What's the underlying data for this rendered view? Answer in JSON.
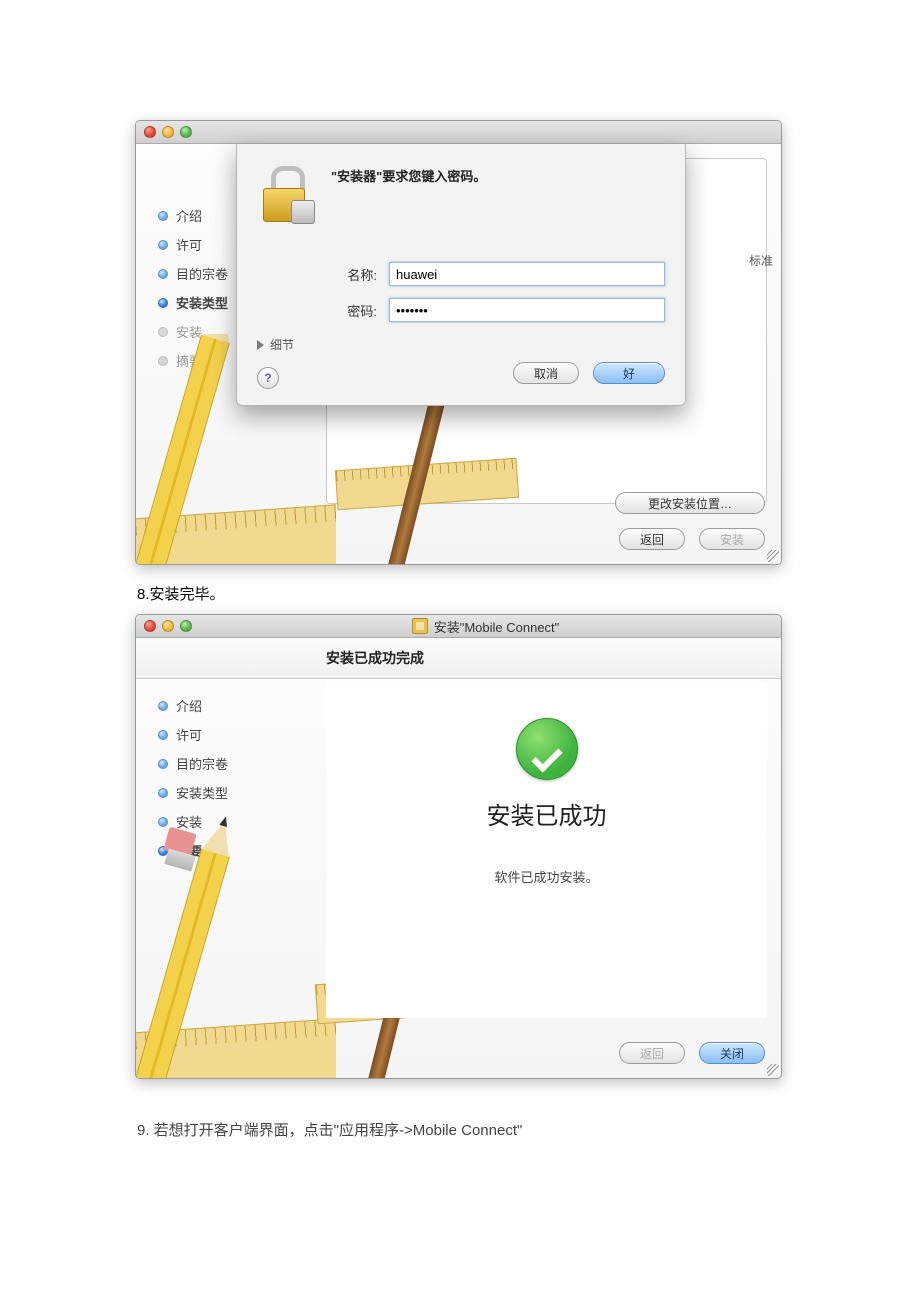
{
  "doc": {
    "caption8": "8.安装完毕。",
    "caption9": "9.  若想打开客户端界面，点击\"应用程序->Mobile Connect\""
  },
  "win1": {
    "peek_label": "标准",
    "sidebar_steps": [
      {
        "label": "介绍",
        "state": "done"
      },
      {
        "label": "许可",
        "state": "done"
      },
      {
        "label": "目的宗卷",
        "state": "done"
      },
      {
        "label": "安装类型",
        "state": "cur"
      },
      {
        "label": "安装",
        "state": "dim"
      },
      {
        "label": "摘要",
        "state": "dim"
      }
    ],
    "change_location_btn": "更改安装位置…",
    "back_btn": "返回",
    "install_btn": "安装",
    "sheet": {
      "message": "\"安装器\"要求您键入密码。",
      "name_label": "名称:",
      "name_value": "huawei",
      "password_label": "密码:",
      "password_value": "•••••••",
      "details_toggle": "细节",
      "help_glyph": "?",
      "cancel_btn": "取消",
      "ok_btn": "好"
    }
  },
  "win2": {
    "title": "安装\"Mobile Connect\"",
    "header": "安装已成功完成",
    "sidebar_steps": [
      {
        "label": "介绍",
        "state": "done"
      },
      {
        "label": "许可",
        "state": "done"
      },
      {
        "label": "目的宗卷",
        "state": "done"
      },
      {
        "label": "安装类型",
        "state": "done"
      },
      {
        "label": "安装",
        "state": "done"
      },
      {
        "label": "摘要",
        "state": "cur"
      }
    ],
    "big_text": "安装已成功",
    "sub_text": "软件已成功安装。",
    "back_btn": "返回",
    "close_btn": "关闭"
  }
}
